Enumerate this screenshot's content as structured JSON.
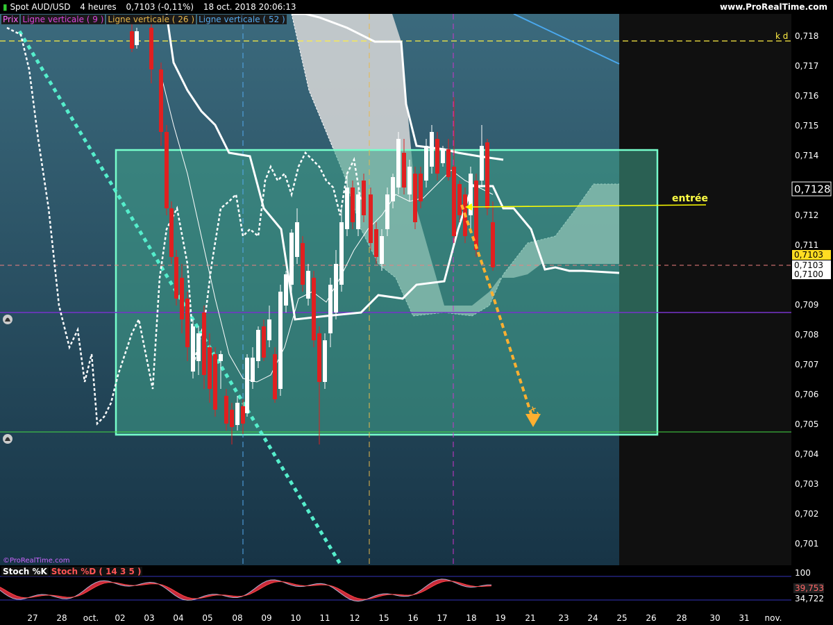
{
  "header": {
    "symbol": "Spot AUD/USD",
    "timeframe": "4 heures",
    "price": "0,7103 (-0,11%)",
    "datetime": "18 oct. 2018 20:06:13",
    "site": "www.ProRealTime.com"
  },
  "legend": {
    "items": [
      {
        "label": "Prix",
        "color": "#ff66ff"
      },
      {
        "label": "Ligne verticale ( 9 )",
        "color": "#cc33cc"
      },
      {
        "label": "Ligne verticale ( 26 )",
        "color": "#e8b84a"
      },
      {
        "label": "Ligne verticale ( 52 )",
        "color": "#55aaee"
      }
    ]
  },
  "annotations": {
    "kd_label": "k d",
    "entree": "entrée",
    "target_label": "+2",
    "watermark": "©ProRealTime.com"
  },
  "price_axis": {
    "ticks": [
      "0,718",
      "0,717",
      "0,716",
      "0,715",
      "0,714",
      "0,713",
      "0,712",
      "0,711",
      "0,710",
      "0,709",
      "0,708",
      "0,707",
      "0,706",
      "0,705",
      "0,704",
      "0,703",
      "0,702",
      "0,701"
    ],
    "badges": [
      {
        "text": "0,7128",
        "kind": "current"
      },
      {
        "text": "0,7103",
        "kind": "last"
      },
      {
        "text": "0,7103",
        "kind": "plain"
      },
      {
        "text": "0,7100",
        "kind": "plain"
      }
    ]
  },
  "oscillator": {
    "legend": [
      "Stoch %K",
      "Stoch %D ( 14 3 5 )"
    ],
    "axis_top": "100",
    "k_value": "39,753",
    "d_value": "34,722"
  },
  "date_axis": {
    "labels": [
      "27",
      "28",
      "oct.",
      "02",
      "03",
      "04",
      "05",
      "08",
      "09",
      "10",
      "11",
      "12",
      "15",
      "16",
      "17",
      "18",
      "19",
      "21",
      "23",
      "24",
      "25",
      "26",
      "28",
      "30",
      "31",
      "nov."
    ]
  },
  "colors": {
    "candle_up": "#ffffff",
    "candle_down": "#e02020",
    "box": "#77ffcc",
    "entry_arrow": "#ffff00",
    "target_arrow": "#ffb030",
    "trend": "#55eecc"
  }
}
